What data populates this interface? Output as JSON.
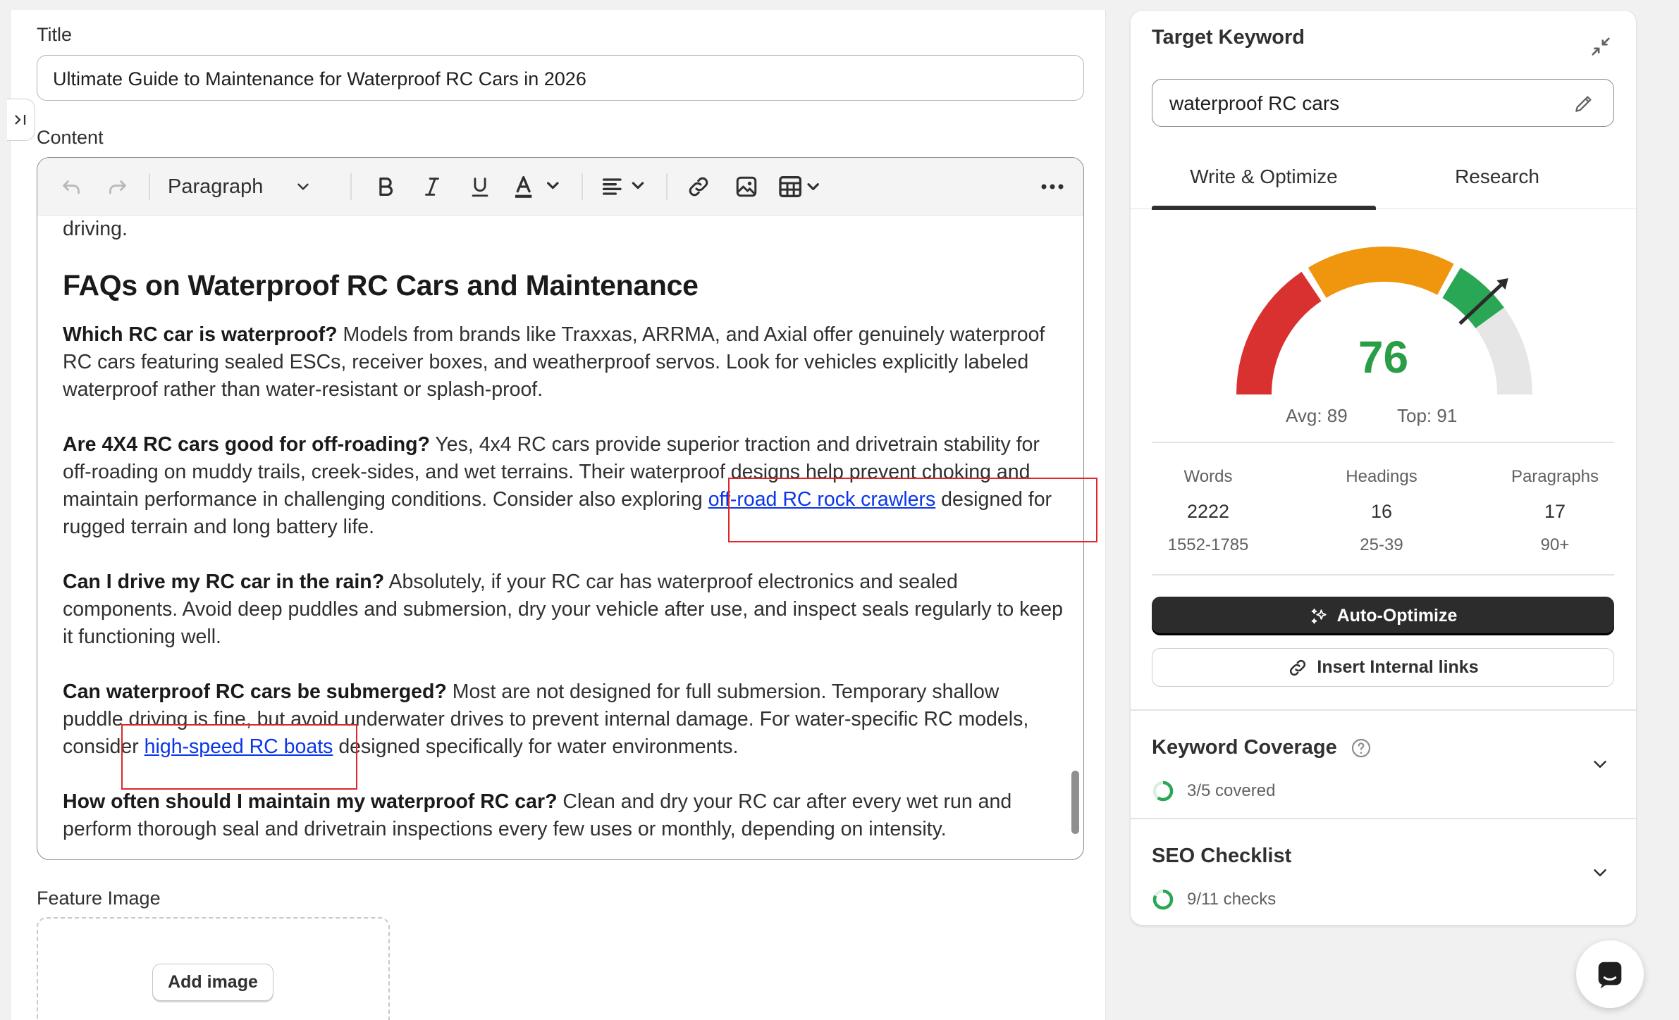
{
  "title_field": {
    "label": "Title",
    "value": "Ultimate Guide to Maintenance for Waterproof RC Cars in 2026"
  },
  "content_field": {
    "label": "Content"
  },
  "toolbar": {
    "undo_icon": "undo-icon",
    "redo_icon": "redo-icon",
    "block_format": "Paragraph",
    "bold_icon": "bold-icon",
    "italic_icon": "italic-icon",
    "underline_icon": "underline-icon",
    "text_color_icon": "text-color-icon",
    "align_icon": "align-left-icon",
    "link_icon": "link-icon",
    "image_icon": "image-icon",
    "table_icon": "table-icon",
    "more_icon": "more-horizontal-icon"
  },
  "content": {
    "top_fragment": "driving.",
    "heading": "FAQs on Waterproof RC Cars and Maintenance",
    "faqs": [
      {
        "q": "Which RC car is waterproof?",
        "a": " Models from brands like Traxxas, ARRMA, and Axial offer genuinely waterproof RC cars featuring sealed ESCs, receiver boxes, and weatherproof servos. Look for vehicles explicitly labeled waterproof rather than water-resistant or splash-proof."
      },
      {
        "q": "Are 4X4 RC cars good for off-roading?",
        "a": " Yes, 4x4 RC cars provide superior traction and drivetrain stability for off-roading on muddy trails, creek-sides, and wet terrains. Their waterproof designs help prevent choking and maintain performance in challenging conditions. Consider also exploring ",
        "link": "off-road RC rock crawlers",
        "a2": " designed for rugged terrain and long battery life."
      },
      {
        "q": "Can I drive my RC car in the rain?",
        "a": " Absolutely, if your RC car has waterproof electronics and sealed components. Avoid deep puddles and submersion, dry your vehicle after use, and inspect seals regularly to keep it functioning well."
      },
      {
        "q": "Can waterproof RC cars be submerged?",
        "a": " Most are not designed for full submersion. Temporary shallow puddle driving is fine, but avoid underwater drives to prevent internal damage. For water-specific RC models, consider ",
        "link": "high-speed RC boats",
        "a2": " designed specifically for water environments."
      },
      {
        "q": "How often should I maintain my waterproof RC car?",
        "a": " Clean and dry your RC car after every wet run and perform thorough seal and drivetrain inspections every few uses or monthly, depending on intensity."
      }
    ]
  },
  "feature_image": {
    "label": "Feature Image",
    "button": "Add image"
  },
  "sidebar": {
    "title": "Target Keyword",
    "keyword": "waterproof RC cars",
    "tabs": [
      "Write & Optimize",
      "Research"
    ],
    "active_tab": "Write & Optimize",
    "score": "76",
    "score_value": 76,
    "avg": "Avg: 89",
    "top": "Top: 91",
    "stats": [
      {
        "label": "Words",
        "value": "2222",
        "range": "1552-1785"
      },
      {
        "label": "Headings",
        "value": "16",
        "range": "25-39"
      },
      {
        "label": "Paragraphs",
        "value": "17",
        "range": "90+"
      }
    ],
    "auto_optimize": "Auto-Optimize",
    "insert_links": "Insert Internal links",
    "keyword_coverage": {
      "title": "Keyword Coverage",
      "status": "3/5 covered",
      "fraction": 0.6
    },
    "seo_checklist": {
      "title": "SEO Checklist",
      "status": "9/11 checks",
      "fraction": 0.818
    }
  },
  "colors": {
    "gauge_red": "#d93030",
    "gauge_orange": "#f0950e",
    "gauge_green": "#2aa754",
    "gauge_grey": "#e6e6e6",
    "score_green": "#2a9d47",
    "link_blue": "#0a36e8",
    "annotation_red": "#e0262b"
  }
}
